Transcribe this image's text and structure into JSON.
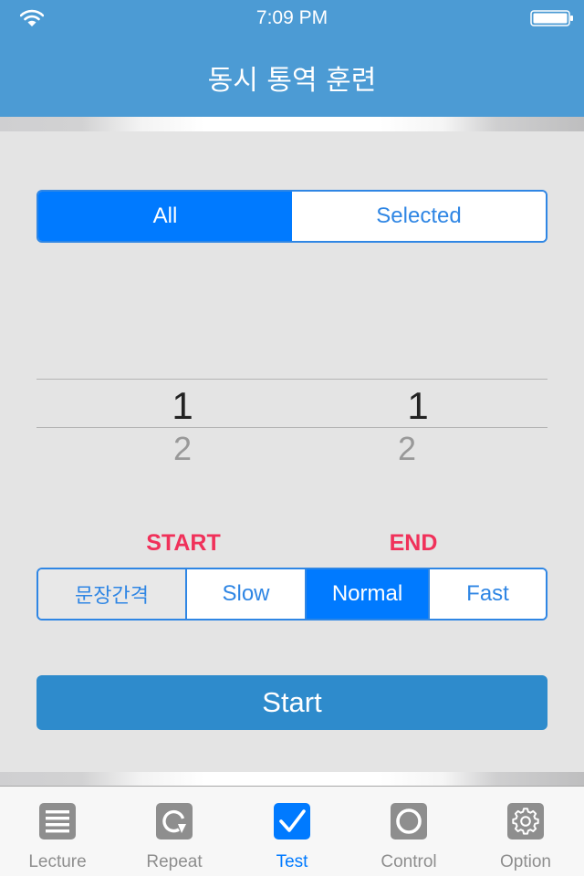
{
  "status_bar": {
    "time": "7:09 PM",
    "wifi_icon": "wifi-icon",
    "battery_icon": "battery-icon"
  },
  "header": {
    "title": "동시 통역 훈련"
  },
  "scope_segment": {
    "options": [
      "All",
      "Selected"
    ],
    "selected": "All"
  },
  "range_picker": {
    "start": {
      "selected": "1",
      "next": "2"
    },
    "end": {
      "selected": "1",
      "next": "2"
    }
  },
  "labels": {
    "start": "START",
    "end": "END"
  },
  "speed_segment": {
    "options": [
      "문장간격",
      "Slow",
      "Normal",
      "Fast"
    ],
    "selected": "Normal"
  },
  "start_button": {
    "label": "Start"
  },
  "colors": {
    "header": "#4c9bd4",
    "accent": "#007aff",
    "label_red": "#f0315a",
    "start_button": "#2e8bcc",
    "inactive_icon": "#8e8e8e"
  },
  "tabbar": {
    "items": [
      {
        "label": "Lecture",
        "icon": "list-icon",
        "active": false
      },
      {
        "label": "Repeat",
        "icon": "repeat-icon",
        "active": false
      },
      {
        "label": "Test",
        "icon": "checkmark-icon",
        "active": true
      },
      {
        "label": "Control",
        "icon": "circle-icon",
        "active": false
      },
      {
        "label": "Option",
        "icon": "gear-icon",
        "active": false
      }
    ]
  }
}
